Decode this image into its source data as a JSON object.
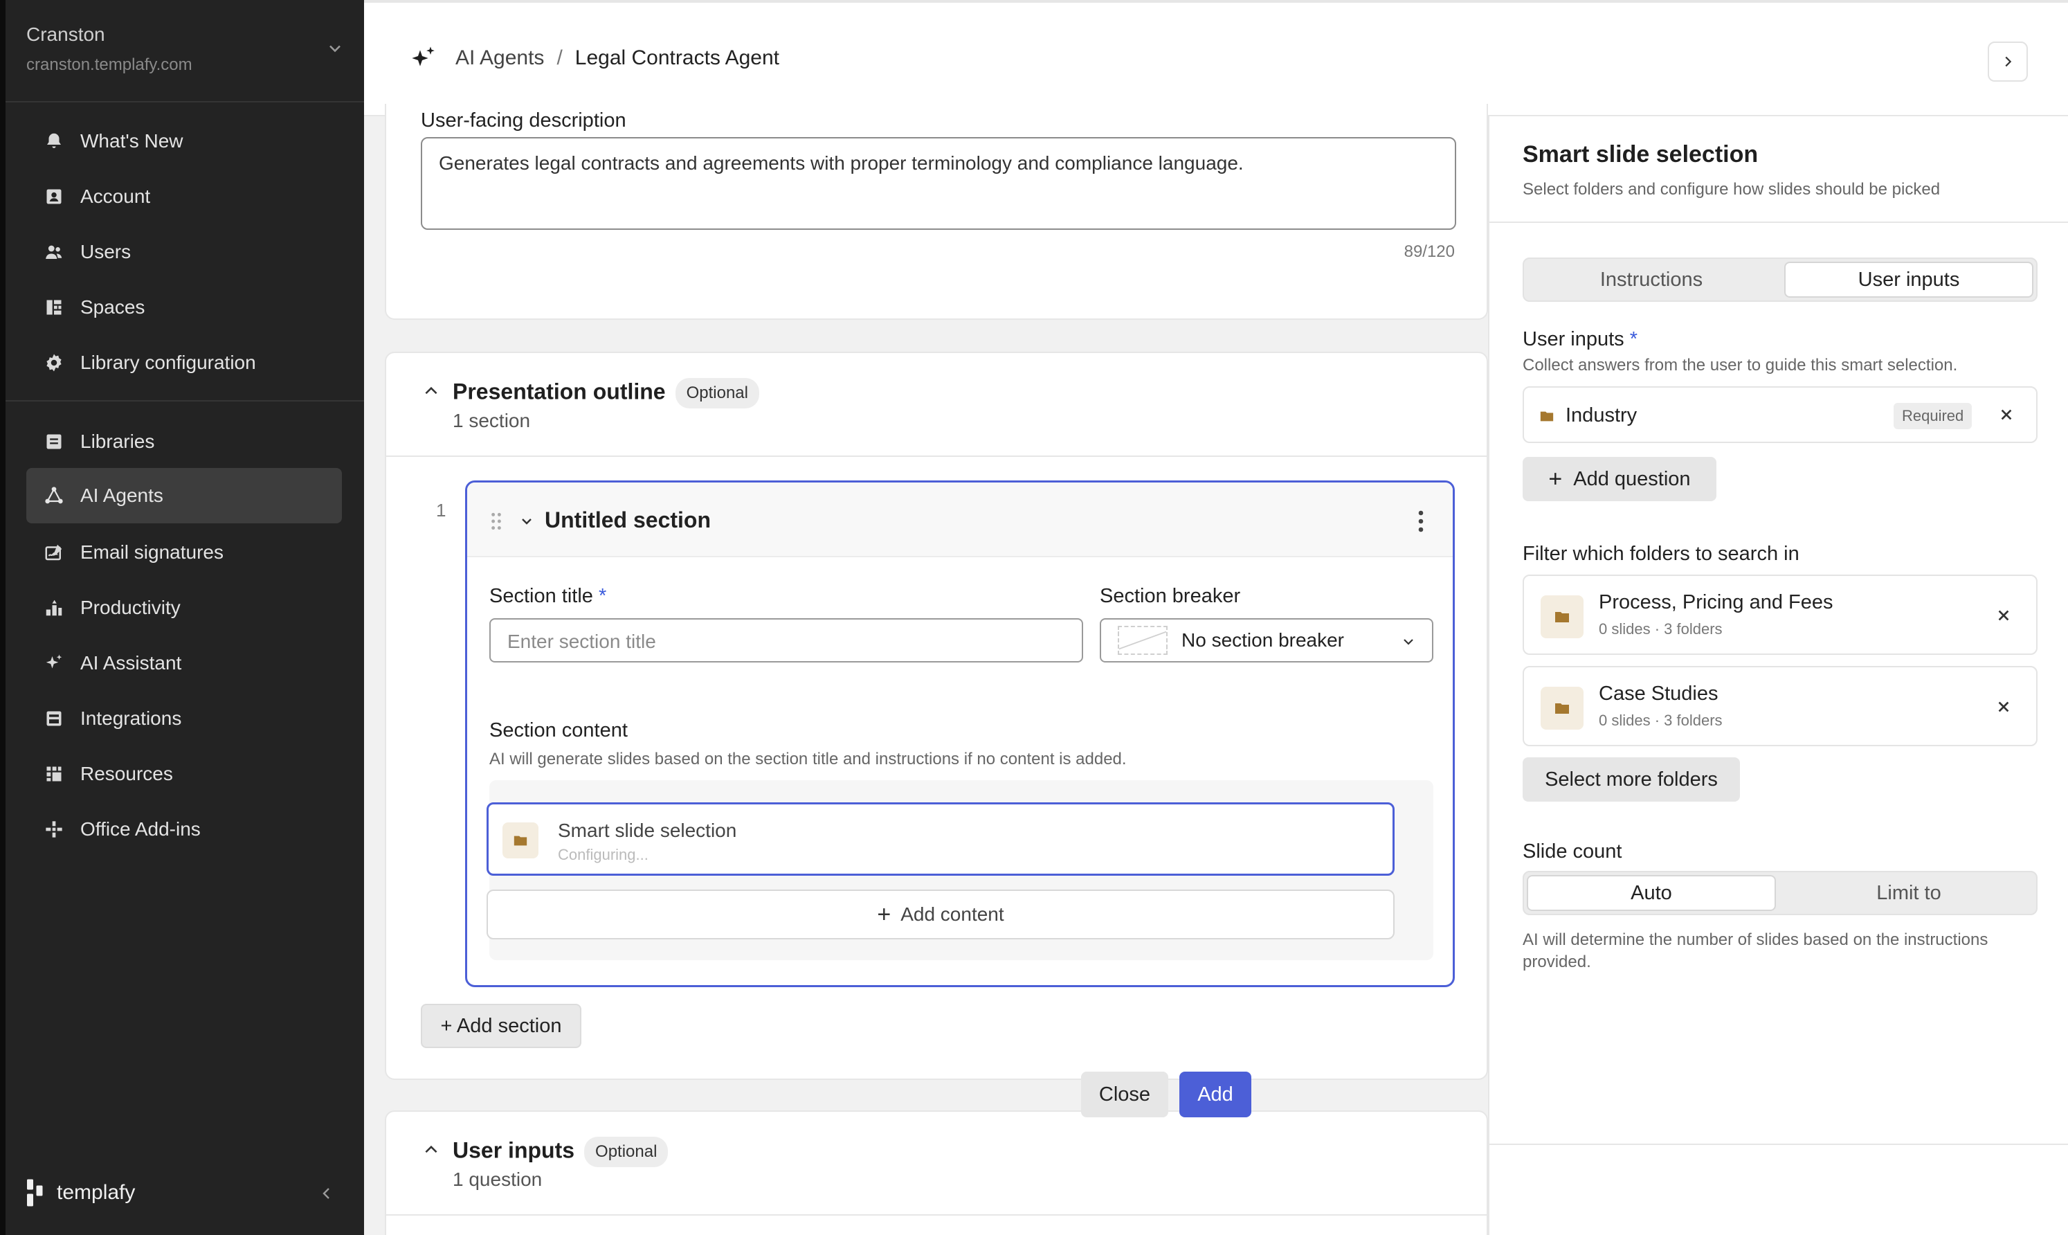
{
  "sidebar": {
    "org_name": "Cranston",
    "org_url": "cranston.templafy.com",
    "group1": [
      {
        "label": "What's New",
        "icon": "bell-icon"
      },
      {
        "label": "Account",
        "icon": "account-icon"
      },
      {
        "label": "Users",
        "icon": "users-icon"
      },
      {
        "label": "Spaces",
        "icon": "spaces-icon"
      },
      {
        "label": "Library configuration",
        "icon": "gear-icon"
      }
    ],
    "group2": [
      {
        "label": "Libraries",
        "icon": "libraries-icon"
      },
      {
        "label": "AI Agents",
        "icon": "ai-agents-icon",
        "active": true
      },
      {
        "label": "Email signatures",
        "icon": "email-signature-icon"
      },
      {
        "label": "Productivity",
        "icon": "productivity-icon"
      },
      {
        "label": "AI Assistant",
        "icon": "sparkle-icon"
      },
      {
        "label": "Integrations",
        "icon": "integrations-icon"
      },
      {
        "label": "Resources",
        "icon": "resources-icon"
      },
      {
        "label": "Office Add-ins",
        "icon": "office-addins-icon"
      }
    ],
    "brand": "templafy"
  },
  "header": {
    "breadcrumb_root": "AI Agents",
    "breadcrumb_sep": "/",
    "breadcrumb_current": "Legal Contracts Agent"
  },
  "description": {
    "label": "User-facing description",
    "value": "Generates legal contracts and agreements with proper terminology and compliance language.",
    "counter": "89/120"
  },
  "outline": {
    "title": "Presentation outline",
    "badge": "Optional",
    "subtitle": "1 section",
    "index": "1",
    "section": {
      "title": "Untitled section",
      "title_label": "Section title",
      "required_mark": "*",
      "title_placeholder": "Enter section title",
      "breaker_label": "Section breaker",
      "breaker_value": "No section breaker",
      "content_label": "Section content",
      "content_hint": "AI will generate slides based on the section title and instructions if no content is added.",
      "smart_title": "Smart slide selection",
      "smart_status": "Configuring...",
      "add_content": "Add content"
    },
    "add_section": "+ Add section"
  },
  "user_inputs_card": {
    "title": "User inputs",
    "badge": "Optional",
    "subtitle": "1 question"
  },
  "panel": {
    "title": "Smart slide selection",
    "subtitle": "Select folders and configure how slides should be picked",
    "tabs": [
      "Instructions",
      "User inputs"
    ],
    "active_tab": "User inputs",
    "inputs_label": "User inputs",
    "required_mark": "*",
    "inputs_hint": "Collect answers from the user to guide this smart selection.",
    "question": {
      "name": "Industry",
      "badge": "Required"
    },
    "add_question": "Add question",
    "filter_label": "Filter which folders to search in",
    "folders": [
      {
        "name": "Process, Pricing and Fees",
        "meta": "0 slides · 3 folders"
      },
      {
        "name": "Case Studies",
        "meta": "0 slides · 3 folders"
      }
    ],
    "select_more": "Select more folders",
    "count_label": "Slide count",
    "count_options": [
      "Auto",
      "Limit to"
    ],
    "count_active": "Auto",
    "count_hint": "AI will determine the number of slides based on the instructions provided.",
    "close": "Close",
    "add": "Add"
  },
  "colors": {
    "accent": "#4c5fd7",
    "sidebar_bg": "#232323",
    "folder": "#a5782f"
  }
}
